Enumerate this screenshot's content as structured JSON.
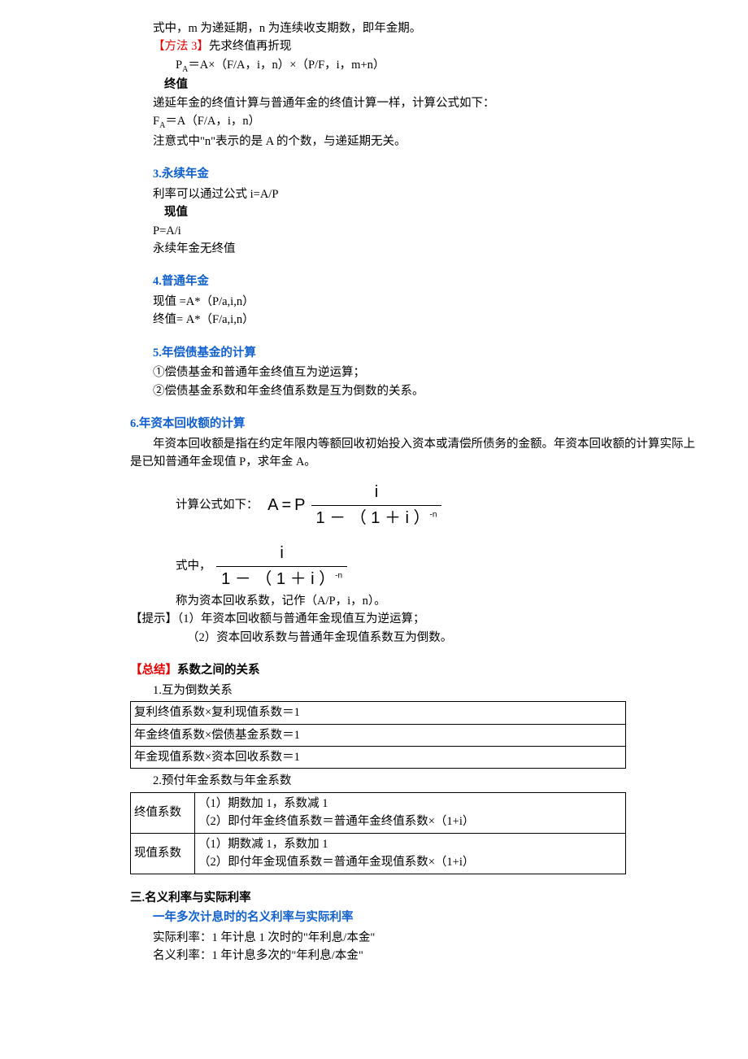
{
  "top": {
    "line1": "式中，m 为递延期，n 为连续收支期数，即年金期。",
    "method3_label": "【方法 3】",
    "method3_text": "先求终值再折现",
    "formula1": "PA＝A×（F/A，i，n）×（P/F，i，m+n）",
    "finalvalue_label": "终值",
    "fv_desc": "递延年金的终值计算与普通年金的终值计算一样，计算公式如下：",
    "fv_formula": "FA＝A（F/A，i，n）",
    "fv_note": "注意式中\"n\"表示的是 A 的个数，与递延期无关。"
  },
  "s3": {
    "heading": "3.永续年金",
    "line1": "利率可以通过公式 i=A/P",
    "pv_label": "现值",
    "pv_formula": "P=A/i",
    "note": "永续年金无终值"
  },
  "s4": {
    "heading": "4.普通年金",
    "pv": "现值 =A*（P/a,i,n）",
    "fv": "终值= A*（F/a,i,n）"
  },
  "s5": {
    "heading": "5.年偿债基金的计算",
    "l1": "①偿债基金和普通年金终值互为逆运算；",
    "l2": "②偿债基金系数和年金终值系数是互为倒数的关系。"
  },
  "s6": {
    "heading": "6.年资本回收额的计算",
    "para": "年资本回收额是指在约定年限内等额回收初始投入资本或清偿所债务的金额。年资本回收额的计算实际上是已知普通年金现值 P，求年金 A。",
    "calc_label": "计算公式如下：",
    "eq_left_A": "A",
    "eq_eq": "=",
    "eq_P": "P",
    "num_i": "i",
    "den_text1": "1 － （ 1 ＋ i ）",
    "den_sup": "-n",
    "in_label": "式中，",
    "note1": "称为资本回收系数，记作（A/P，i，n）。",
    "tip_label": "【提示】",
    "tip1": "（1）年资本回收额与普通年金现值互为逆运算；",
    "tip2": "（2）资本回收系数与普通年金现值系数互为倒数。"
  },
  "summary": {
    "label": "【总结】",
    "title": "系数之间的关系",
    "sub1": "1.互为倒数关系",
    "t1r1": "复利终值系数×复利现值系数＝1",
    "t1r2": "年金终值系数×偿债基金系数＝1",
    "t1r3": "年金现值系数×资本回收系数＝1",
    "sub2": "2.预付年金系数与年金系数",
    "t2r1c1": "终值系数",
    "t2r1c2a": "（1）期数加 1，系数减 1",
    "t2r1c2b": "（2）即付年金终值系数＝普通年金终值系数×（1+i）",
    "t2r2c1": "现值系数",
    "t2r2c2a": "（1）期数减 1，系数加 1",
    "t2r2c2b": "（2）即付年金现值系数＝普通年金现值系数×（1+i）"
  },
  "s7": {
    "heading": "三.名义利率与实际利率",
    "sub": "一年多次计息时的名义利率与实际利率",
    "l1": "实际利率：1 年计息 1 次时的\"年利息/本金\"",
    "l2": "名义利率：1 年计息多次的\"年利息/本金\""
  }
}
